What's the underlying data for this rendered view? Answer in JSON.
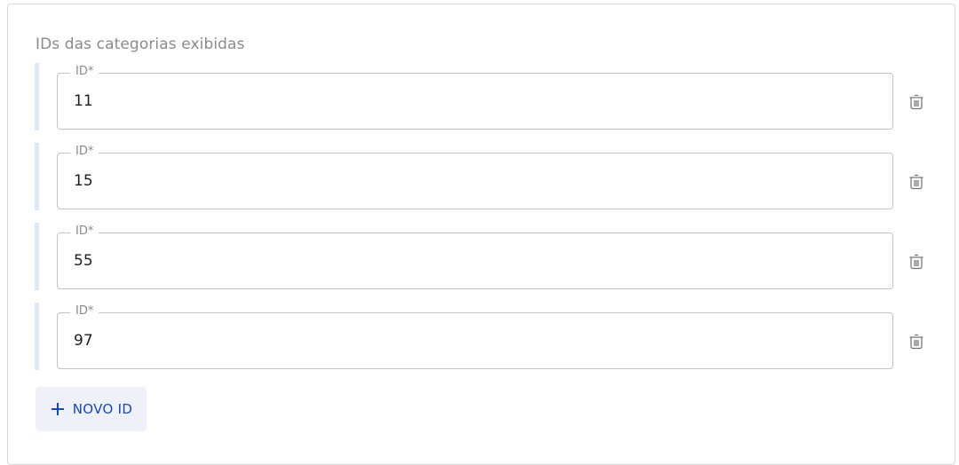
{
  "section": {
    "title": "IDs das categorias exibidas"
  },
  "rows": [
    {
      "label": "ID*",
      "value": "11"
    },
    {
      "label": "ID*",
      "value": "15"
    },
    {
      "label": "ID*",
      "value": "55"
    },
    {
      "label": "ID*",
      "value": "97"
    }
  ],
  "actions": {
    "add_label": "NOVO ID",
    "add_icon": "plus-icon",
    "delete_icon": "trash-icon"
  },
  "colors": {
    "accent": "#1447c4",
    "accent_bg": "#eef2f8",
    "row_bar": "#dde8f8",
    "muted_text": "#8a8a8a",
    "border": "#c4c4c4"
  }
}
